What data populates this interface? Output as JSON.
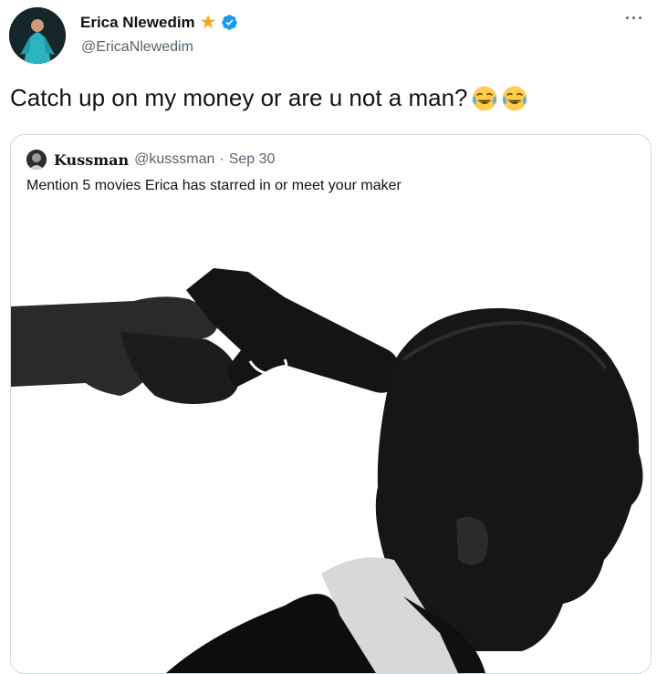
{
  "tweet": {
    "author_name": "Erica Nlewedim",
    "author_handle": "@EricaNlewedim",
    "more_label": "···",
    "text": "Catch up on my money or are u not a man?",
    "emoji": [
      "face-with-tears-of-joy",
      "face-with-tears-of-joy"
    ]
  },
  "quoted_tweet": {
    "author_name": "Kussman",
    "author_handle": "@kusssman",
    "separator": "·",
    "date": "Sep 30",
    "text": "Mention 5 movies Erica has starred in or meet your maker"
  },
  "colors": {
    "verified": "#1d9bf0",
    "star": "#f5a623",
    "secondary_text": "#536471",
    "border": "#cfd9de"
  }
}
